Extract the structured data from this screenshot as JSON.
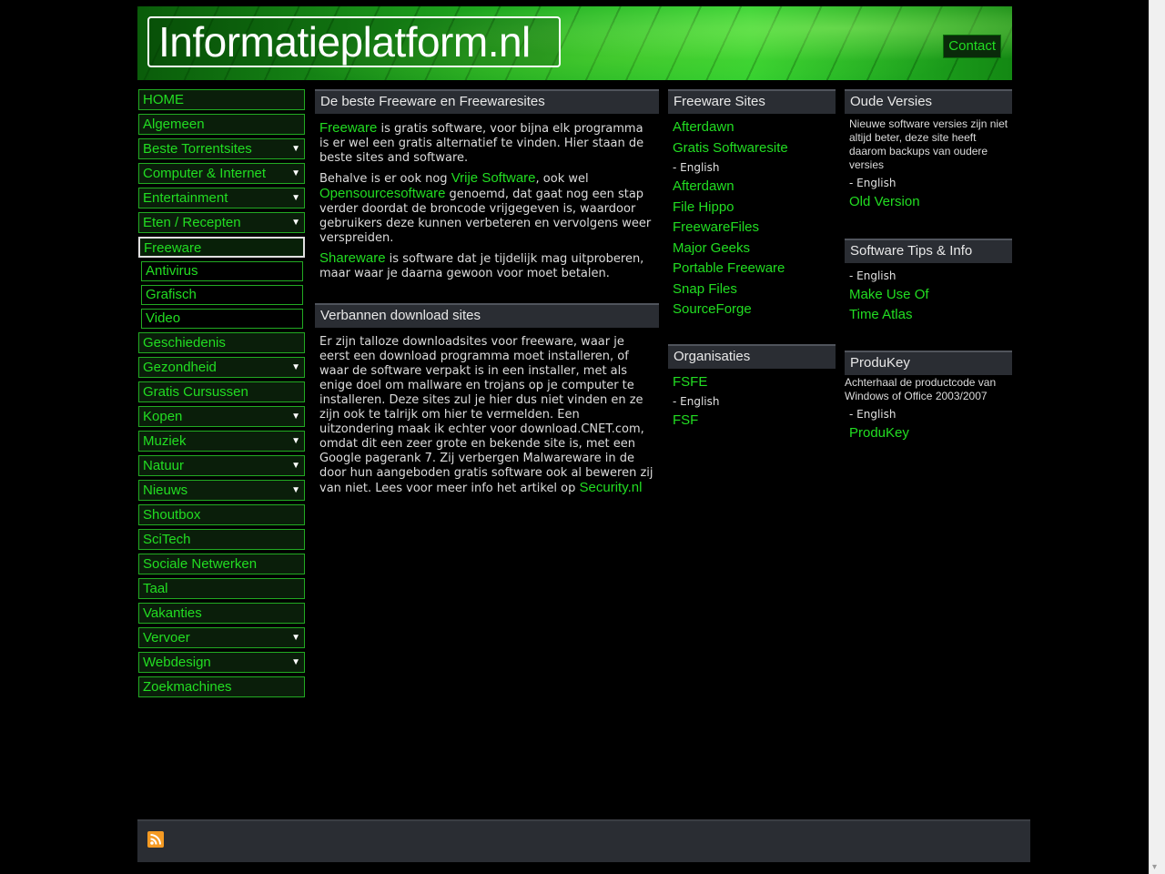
{
  "header": {
    "logo": "Informatieplatform.nl",
    "contact": "Contact"
  },
  "nav": {
    "items": [
      {
        "label": "HOME",
        "arrow": ""
      },
      {
        "label": "Algemeen",
        "arrow": ""
      },
      {
        "label": "Beste Torrentsites",
        "arrow": "▼"
      },
      {
        "label": "Computer & Internet",
        "arrow": "▼"
      },
      {
        "label": "Entertainment",
        "arrow": "▼"
      },
      {
        "label": "Eten / Recepten",
        "arrow": "▼"
      },
      {
        "label": "Freeware",
        "arrow": ""
      },
      {
        "label": "Geschiedenis",
        "arrow": ""
      },
      {
        "label": "Gezondheid",
        "arrow": "▼"
      },
      {
        "label": "Gratis Cursussen",
        "arrow": ""
      },
      {
        "label": "Kopen",
        "arrow": "▼"
      },
      {
        "label": "Muziek",
        "arrow": "▼"
      },
      {
        "label": "Natuur",
        "arrow": "▼"
      },
      {
        "label": "Nieuws",
        "arrow": "▼"
      },
      {
        "label": "Shoutbox",
        "arrow": ""
      },
      {
        "label": "SciTech",
        "arrow": ""
      },
      {
        "label": "Sociale Netwerken",
        "arrow": ""
      },
      {
        "label": "Taal",
        "arrow": ""
      },
      {
        "label": "Vakanties",
        "arrow": ""
      },
      {
        "label": "Vervoer",
        "arrow": "▼"
      },
      {
        "label": "Webdesign",
        "arrow": "▼"
      },
      {
        "label": "Zoekmachines",
        "arrow": ""
      }
    ],
    "sub_items": [
      "Antivirus",
      "Grafisch",
      "Video"
    ]
  },
  "main": {
    "freeware": {
      "title": "De beste Freeware en Freewaresites",
      "p1_link": "Freeware",
      "p1_text": " is gratis software, voor bijna elk programma is er wel een gratis alternatief te vinden. Hier staan de beste sites and software.",
      "p2_text_a": "Behalve is er ook nog ",
      "p2_link_a": "Vrije Software",
      "p2_text_b": ", ook wel ",
      "p2_link_b": "Opensourcesoftware",
      "p2_text_c": " genoemd, dat gaat nog een stap verder doordat de broncode vrijgegeven is, waardoor gebruikers deze kunnen verbeteren en vervolgens weer verspreiden.",
      "p3_link": "Shareware",
      "p3_text": " is software dat je tijdelijk mag uitproberen, maar waar je daarna gewoon voor moet betalen."
    },
    "banned": {
      "title": "Verbannen download sites",
      "text": "Er zijn talloze downloadsites voor freeware, waar je eerst een download programma moet installeren, of waar de software verpakt is in een installer, met als enige doel om mallware en trojans op je computer te installeren. Deze sites zul je hier dus niet vinden en ze zijn ook te talrijk om hier te vermelden. Een uitzondering maak ik echter voor download.CNET.com, omdat dit een zeer grote en bekende site is, met een Google pagerank 7. Zij verbergen Malwareware in de door hun aangeboden gratis software ook al beweren zij van niet. Lees voor meer info het artikel op ",
      "link": "Security.nl"
    }
  },
  "freeware_sites": {
    "title": "Freeware Sites",
    "top_links": [
      "Afterdawn",
      "Gratis Softwaresite"
    ],
    "lang": "- English",
    "links": [
      "Afterdawn",
      "File Hippo",
      "FreewareFiles",
      "Major Geeks",
      "Portable Freeware",
      "Snap Files",
      "SourceForge"
    ]
  },
  "organisaties": {
    "title": "Organisaties",
    "top_link": "FSFE",
    "lang": "- English",
    "link": "FSF"
  },
  "oude_versies": {
    "title": "Oude Versies",
    "text": "Nieuwe software versies zijn niet altijd beter, deze site heeft daarom backups van oudere versies",
    "lang": "- English",
    "link": "Old Version"
  },
  "tips": {
    "title": "Software Tips & Info",
    "lang": "- English",
    "links": [
      "Make Use Of",
      "Time Atlas"
    ]
  },
  "produkey": {
    "title": "ProduKey",
    "text": "Achterhaal de productcode van Windows of Office 2003/2007",
    "lang": "- English",
    "link": "ProduKey"
  }
}
